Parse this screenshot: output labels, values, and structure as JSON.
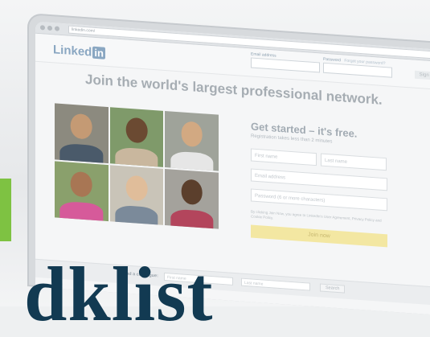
{
  "browser": {
    "url": "linkedin.com/"
  },
  "header": {
    "logo_text": "Linked",
    "logo_badge": "in",
    "email_label": "Email address",
    "password_label": "Password",
    "forgot_password": "Forgot your password?",
    "signin_label": "Sign in"
  },
  "main": {
    "headline": "Join the world's largest professional network.",
    "signup": {
      "title": "Get started – it's free.",
      "subtitle": "Registration takes less than 2 minutes",
      "first_name_placeholder": "First name",
      "last_name_placeholder": "Last name",
      "email_placeholder": "Email address",
      "password_placeholder": "Password (6 or more characters)",
      "legal_text": "By clicking Join Now, you agree to LinkedIn's User Agreement, Privacy Policy and Cookie Policy.",
      "join_label": "Join now"
    },
    "photos": [
      {
        "bg": "#8c8a7f",
        "skin": "#c49a74",
        "shirt": "#4a5a6a"
      },
      {
        "bg": "#7f9a6a",
        "skin": "#6b4a32",
        "shirt": "#c9b79e"
      },
      {
        "bg": "#9fa39a",
        "skin": "#d2a982",
        "shirt": "#e6e6e6"
      },
      {
        "bg": "#8aa06c",
        "skin": "#a87654",
        "shirt": "#d65a9a"
      },
      {
        "bg": "#c9c4b8",
        "skin": "#e0bd9a",
        "shirt": "#7b8a9a"
      },
      {
        "bg": "#a4a29c",
        "skin": "#5b3f2c",
        "shirt": "#b3455c"
      }
    ]
  },
  "footer": {
    "find_label": "Find a colleague:",
    "first_name_placeholder": "First name",
    "last_name_placeholder": "Last name",
    "search_label": "Search"
  },
  "overlay": {
    "bottom_text": "dklist"
  }
}
